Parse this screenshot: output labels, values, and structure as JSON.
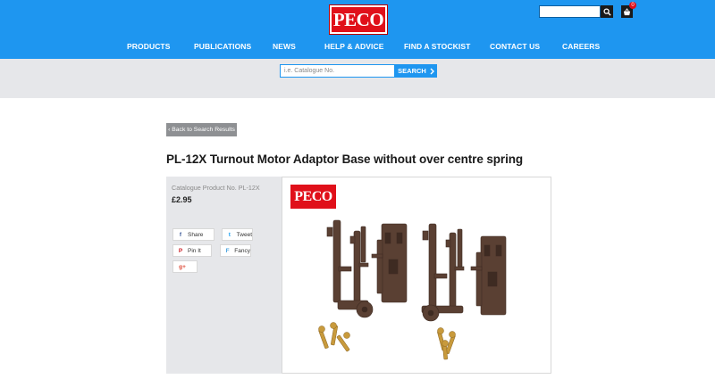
{
  "header": {
    "logo_text": "PECO",
    "basket_count": "0",
    "nav": [
      "PRODUCTS",
      "PUBLICATIONS",
      "NEWS",
      "HELP & ADVICE",
      "FIND A STOCKIST",
      "CONTACT US",
      "CAREERS"
    ]
  },
  "catalogue_search": {
    "placeholder": "i.e. Catalogue No.",
    "button_label": "SEARCH"
  },
  "back_label": "‹ Back to Search Results",
  "product": {
    "title": "PL-12X Turnout Motor Adaptor Base without over centre spring",
    "catalogue_no": "Catalogue Product No. PL-12X",
    "price": "£2.95",
    "image_logo_text": "PECO"
  },
  "share": [
    {
      "label": "Share",
      "icon": "facebook-icon",
      "glyph": "f",
      "color": "#3b5998"
    },
    {
      "label": "Tweet",
      "icon": "twitter-icon",
      "glyph": "t",
      "color": "#1da1f2"
    },
    {
      "label": "Pin It",
      "icon": "pinterest-icon",
      "glyph": "P",
      "color": "#cb2027"
    },
    {
      "label": "Fancy",
      "icon": "fancy-icon",
      "glyph": "F",
      "color": "#4aa3df"
    },
    {
      "label": "",
      "icon": "google-plus-icon",
      "glyph": "g+",
      "color": "#dd4b39"
    }
  ],
  "colors": {
    "brand_blue": "#1e96f0",
    "brand_red": "#e0101a",
    "part_brown": "#5a4033",
    "screw_brass": "#c89a3c"
  }
}
